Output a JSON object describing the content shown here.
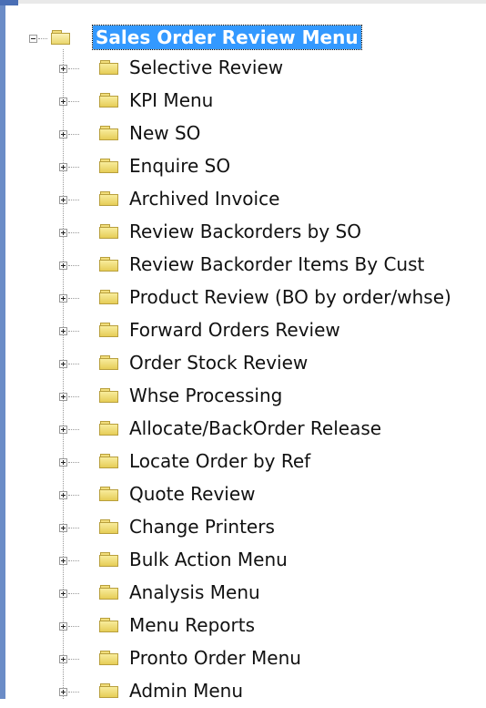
{
  "tree": {
    "root": {
      "label": "Sales Order Review Menu",
      "expanded": true,
      "selected": true
    },
    "items": [
      {
        "label": "Selective Review"
      },
      {
        "label": "KPI Menu"
      },
      {
        "label": "New SO"
      },
      {
        "label": "Enquire SO"
      },
      {
        "label": "Archived Invoice"
      },
      {
        "label": "Review Backorders by SO"
      },
      {
        "label": "Review Backorder Items By Cust"
      },
      {
        "label": "Product Review (BO by order/whse)"
      },
      {
        "label": "Forward Orders Review"
      },
      {
        "label": "Order Stock Review"
      },
      {
        "label": "Whse Processing"
      },
      {
        "label": "Allocate/BackOrder Release"
      },
      {
        "label": "Locate Order by Ref"
      },
      {
        "label": "Quote Review"
      },
      {
        "label": "Change Printers"
      },
      {
        "label": "Bulk Action Menu"
      },
      {
        "label": "Analysis Menu"
      },
      {
        "label": "Menu Reports"
      },
      {
        "label": "Pronto Order Menu"
      },
      {
        "label": "Admin Menu"
      }
    ]
  },
  "icons": {
    "expand": "plus-box-icon",
    "collapse": "minus-box-icon",
    "folder": "folder-icon"
  },
  "colors": {
    "selection": "#3399ff",
    "folder": "#e6cd57",
    "window_edge": "#6b8cc7"
  }
}
